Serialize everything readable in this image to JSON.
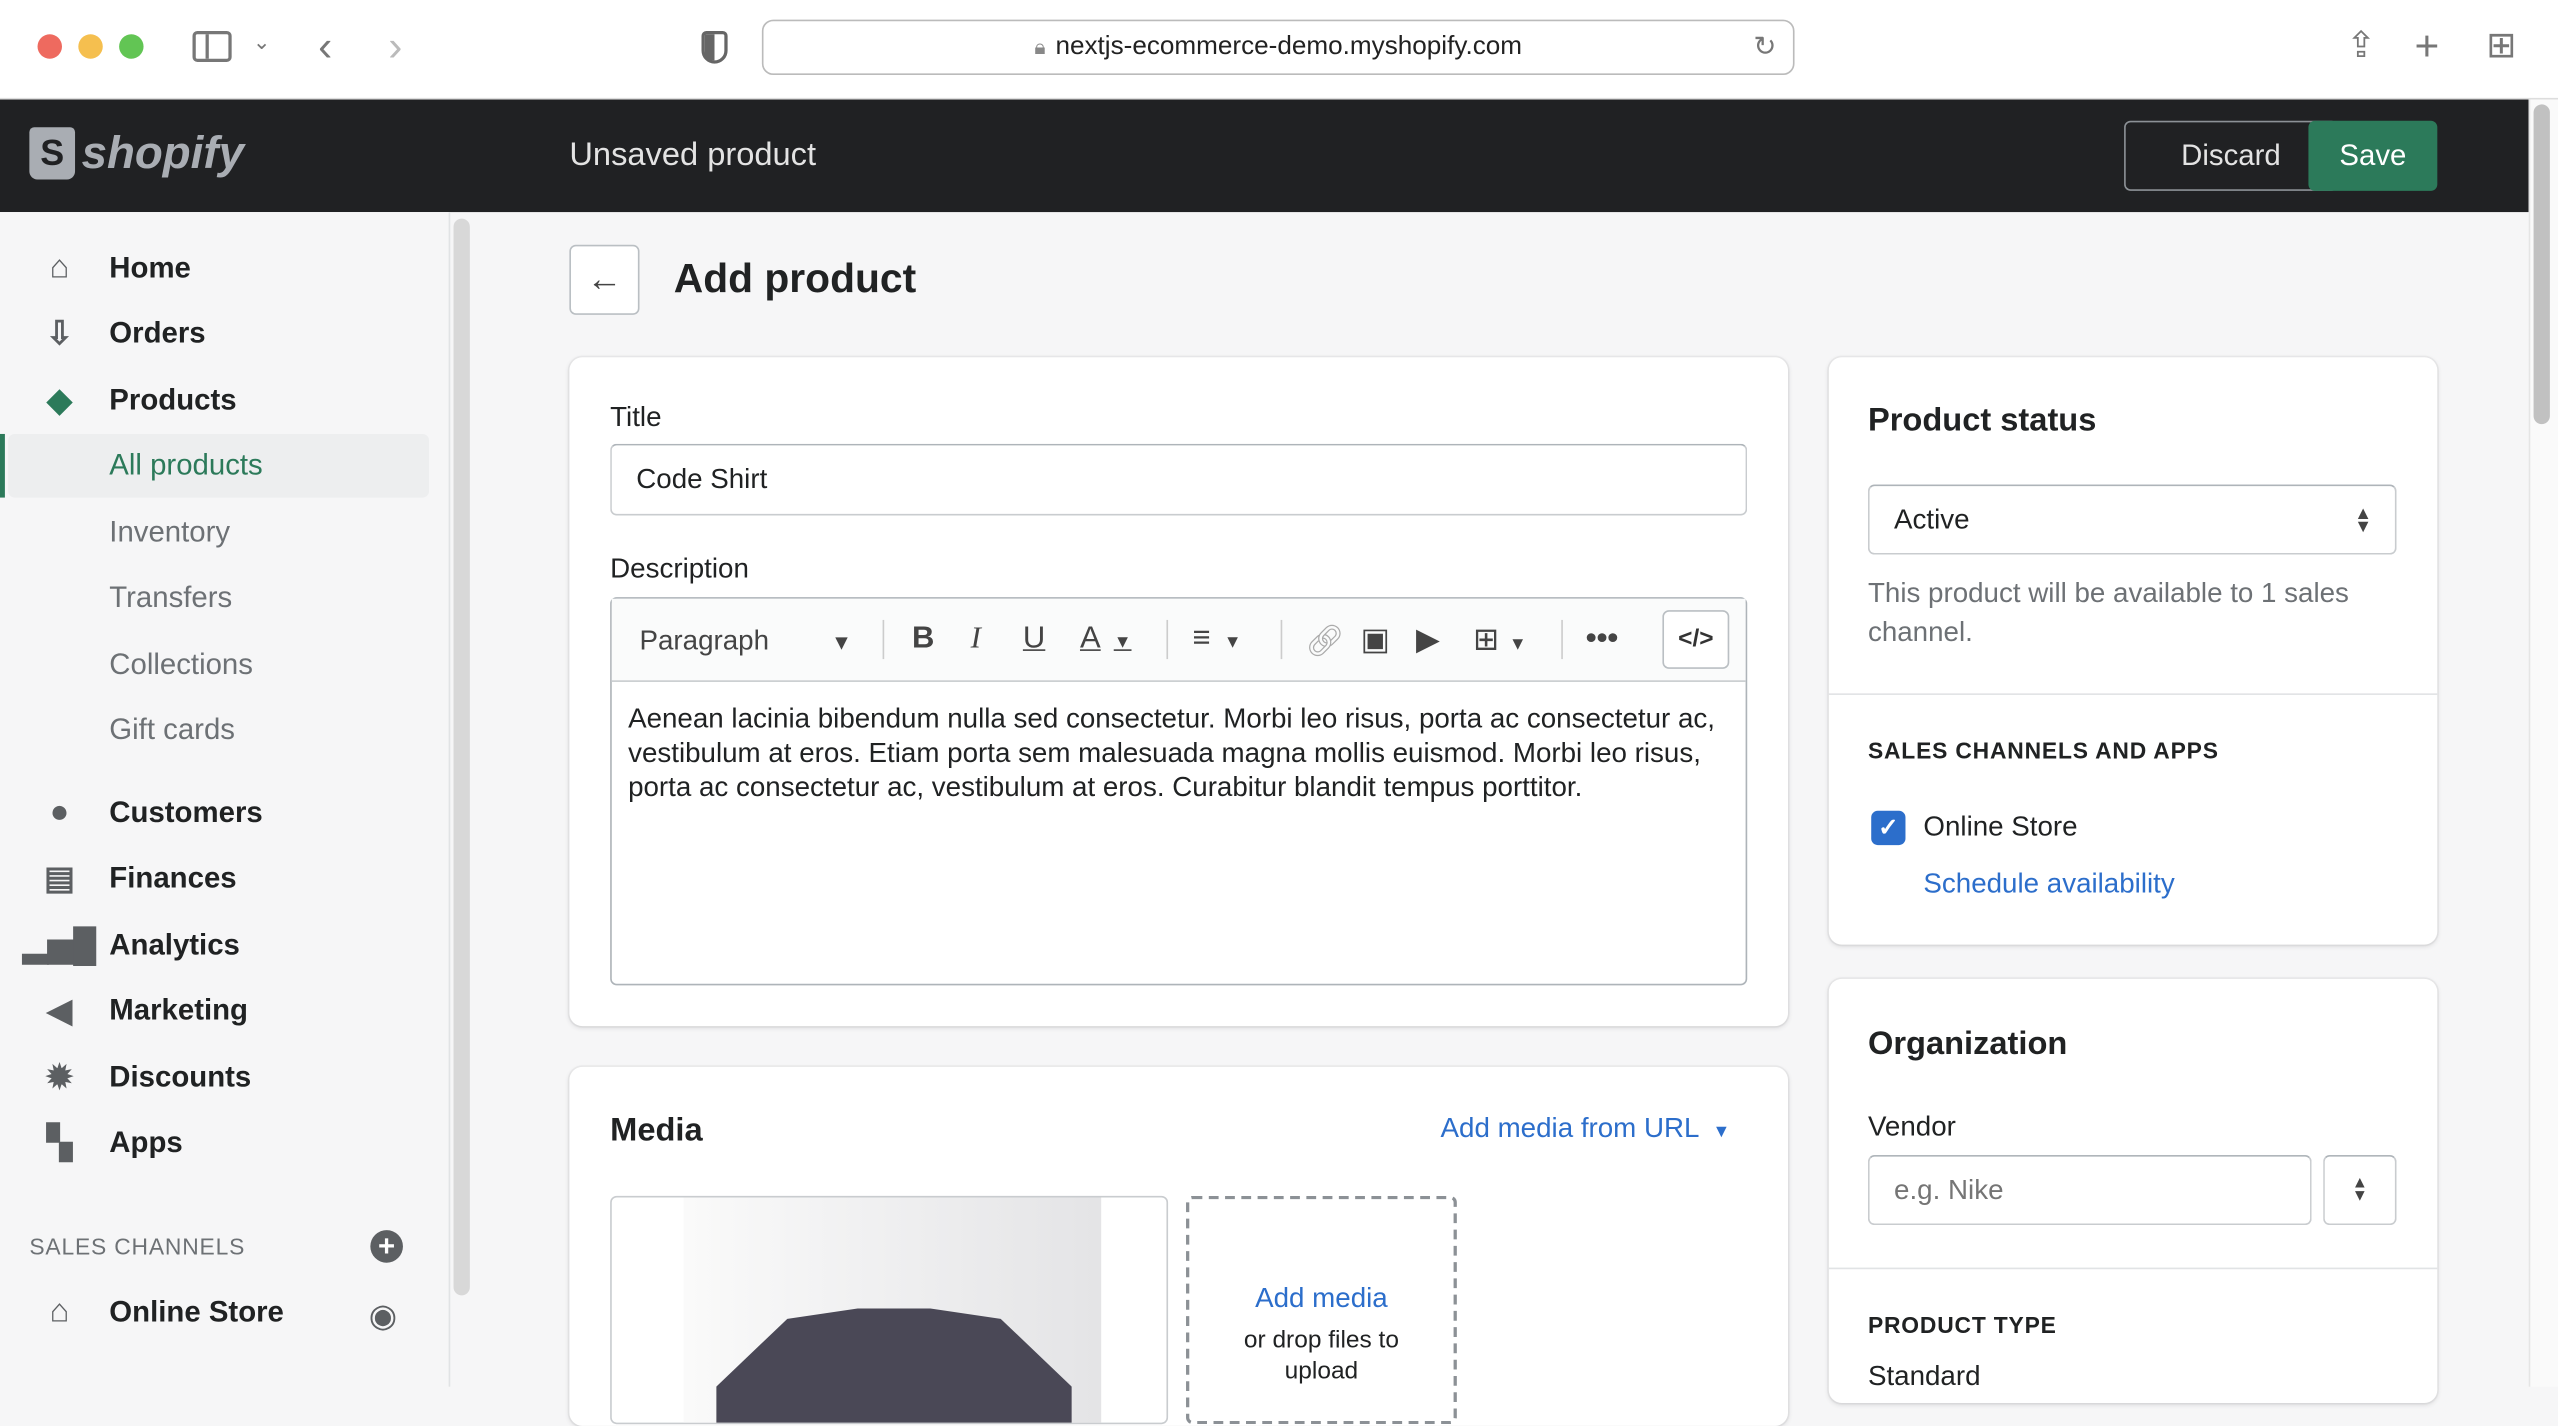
{
  "browser": {
    "url": "nextjs-ecommerce-demo.myshopify.com"
  },
  "topbar": {
    "logo": "shopify",
    "title": "Unsaved product",
    "discard": "Discard",
    "save": "Save",
    "save_color": "#2c7a5a"
  },
  "sidebar": {
    "items": [
      {
        "label": "Home",
        "icon": "home-icon"
      },
      {
        "label": "Orders",
        "icon": "orders-icon"
      },
      {
        "label": "Products",
        "icon": "tag-icon"
      },
      {
        "label": "Customers",
        "icon": "person-icon"
      },
      {
        "label": "Finances",
        "icon": "finances-icon"
      },
      {
        "label": "Analytics",
        "icon": "bar-chart-icon"
      },
      {
        "label": "Marketing",
        "icon": "megaphone-icon"
      },
      {
        "label": "Discounts",
        "icon": "discount-icon"
      },
      {
        "label": "Apps",
        "icon": "apps-icon"
      }
    ],
    "product_subitems": [
      "All products",
      "Inventory",
      "Transfers",
      "Collections",
      "Gift cards"
    ],
    "sales_channels_heading": "SALES CHANNELS",
    "online_store": "Online Store"
  },
  "page": {
    "heading": "Add product"
  },
  "product_form": {
    "title_label": "Title",
    "title_value": "Code Shirt",
    "description_label": "Description",
    "format": "Paragraph",
    "description": "Aenean lacinia bibendum nulla sed consectetur. Morbi leo risus, porta ac consectetur ac, vestibulum at eros. Etiam porta sem malesuada magna mollis euismod. Morbi leo risus, porta ac consectetur ac, vestibulum at eros. Curabitur blandit tempus porttitor."
  },
  "media": {
    "heading": "Media",
    "add_from_url": "Add media from URL",
    "add_media": "Add media",
    "drop_hint": "or drop files to upload"
  },
  "status": {
    "heading": "Product status",
    "value": "Active",
    "help": "This product will be available to 1 sales channel.",
    "channels_heading": "SALES CHANNELS AND APPS",
    "channel": "Online Store",
    "channel_checked": true,
    "schedule": "Schedule availability"
  },
  "organization": {
    "heading": "Organization",
    "vendor_label": "Vendor",
    "vendor_placeholder": "e.g. Nike",
    "type_heading": "PRODUCT TYPE",
    "type_value": "Standard"
  }
}
